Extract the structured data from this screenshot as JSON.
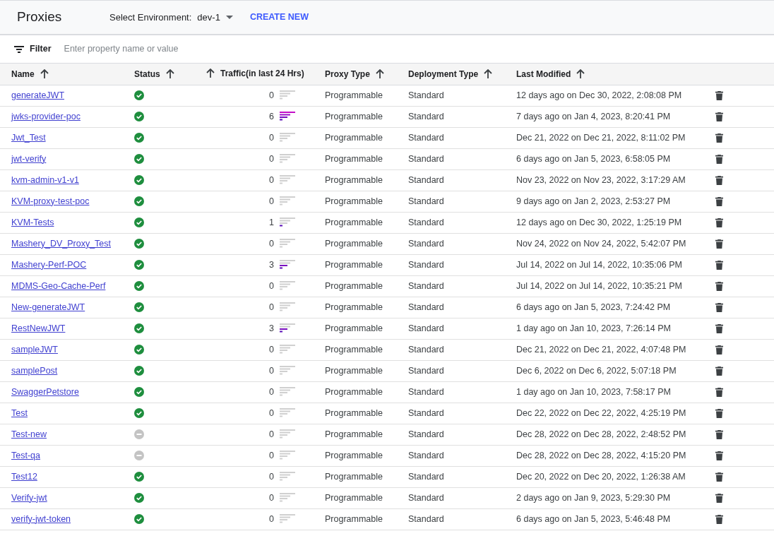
{
  "header": {
    "title": "Proxies",
    "environment_label": "Select Environment:",
    "environment": "dev-1",
    "create_button": "CREATE NEW"
  },
  "filter": {
    "label": "Filter",
    "placeholder": "Enter property name or value"
  },
  "table": {
    "columns": [
      "Name",
      "Status",
      "Traffic(in last 24 Hrs)",
      "Proxy Type",
      "Deployment Type",
      "Last Modified"
    ],
    "rows": [
      {
        "name": "generateJWT",
        "deployed": true,
        "traffic": "0",
        "kind": "idle",
        "proxy_type": "Programmable",
        "deployment_type": "Standard",
        "last_modified": "12 days ago on Dec 30, 2022, 2:08:08 PM"
      },
      {
        "name": "jwks-provider-poc",
        "deployed": true,
        "traffic": "6",
        "kind": "high",
        "proxy_type": "Programmable",
        "deployment_type": "Standard",
        "last_modified": "7 days ago on Jan 4, 2023, 8:20:41 PM"
      },
      {
        "name": "Jwt_Test",
        "deployed": true,
        "traffic": "0",
        "kind": "idle",
        "proxy_type": "Programmable",
        "deployment_type": "Standard",
        "last_modified": "Dec 21, 2022 on Dec 21, 2022, 8:11:02 PM"
      },
      {
        "name": "jwt-verify",
        "deployed": true,
        "traffic": "0",
        "kind": "idle",
        "proxy_type": "Programmable",
        "deployment_type": "Standard",
        "last_modified": "6 days ago on Jan 5, 2023, 6:58:05 PM"
      },
      {
        "name": "kvm-admin-v1-v1",
        "deployed": true,
        "traffic": "0",
        "kind": "idle",
        "proxy_type": "Programmable",
        "deployment_type": "Standard",
        "last_modified": "Nov 23, 2022 on Nov 23, 2022, 3:17:29 AM"
      },
      {
        "name": "KVM-proxy-test-poc",
        "deployed": true,
        "traffic": "0",
        "kind": "idle",
        "proxy_type": "Programmable",
        "deployment_type": "Standard",
        "last_modified": "9 days ago on Jan 2, 2023, 2:53:27 PM"
      },
      {
        "name": "KVM-Tests",
        "deployed": true,
        "traffic": "1",
        "kind": "low",
        "proxy_type": "Programmable",
        "deployment_type": "Standard",
        "last_modified": "12 days ago on Dec 30, 2022, 1:25:19 PM"
      },
      {
        "name": "Mashery_DV_Proxy_Test",
        "deployed": true,
        "traffic": "0",
        "kind": "idle",
        "proxy_type": "Programmable",
        "deployment_type": "Standard",
        "last_modified": "Nov 24, 2022 on Nov 24, 2022, 5:42:07 PM"
      },
      {
        "name": "Mashery-Perf-POC",
        "deployed": true,
        "traffic": "3",
        "kind": "medium",
        "proxy_type": "Programmable",
        "deployment_type": "Standard",
        "last_modified": "Jul 14, 2022 on Jul 14, 2022, 10:35:06 PM"
      },
      {
        "name": "MDMS-Geo-Cache-Perf",
        "deployed": true,
        "traffic": "0",
        "kind": "idle",
        "proxy_type": "Programmable",
        "deployment_type": "Standard",
        "last_modified": "Jul 14, 2022 on Jul 14, 2022, 10:35:21 PM"
      },
      {
        "name": "New-generateJWT",
        "deployed": true,
        "traffic": "0",
        "kind": "idle",
        "proxy_type": "Programmable",
        "deployment_type": "Standard",
        "last_modified": "6 days ago on Jan 5, 2023, 7:24:42 PM"
      },
      {
        "name": "RestNewJWT",
        "deployed": true,
        "traffic": "3",
        "kind": "medium",
        "proxy_type": "Programmable",
        "deployment_type": "Standard",
        "last_modified": "1 day ago on Jan 10, 2023, 7:26:14 PM"
      },
      {
        "name": "sampleJWT",
        "deployed": true,
        "traffic": "0",
        "kind": "idle",
        "proxy_type": "Programmable",
        "deployment_type": "Standard",
        "last_modified": "Dec 21, 2022 on Dec 21, 2022, 4:07:48 PM"
      },
      {
        "name": "samplePost",
        "deployed": true,
        "traffic": "0",
        "kind": "idle",
        "proxy_type": "Programmable",
        "deployment_type": "Standard",
        "last_modified": "Dec 6, 2022 on Dec 6, 2022, 5:07:18 PM"
      },
      {
        "name": "SwaggerPetstore",
        "deployed": true,
        "traffic": "0",
        "kind": "idle",
        "proxy_type": "Programmable",
        "deployment_type": "Standard",
        "last_modified": "1 day ago on Jan 10, 2023, 7:58:17 PM"
      },
      {
        "name": "Test",
        "deployed": true,
        "traffic": "0",
        "kind": "idle",
        "proxy_type": "Programmable",
        "deployment_type": "Standard",
        "last_modified": "Dec 22, 2022 on Dec 22, 2022, 4:25:19 PM"
      },
      {
        "name": "Test-new",
        "deployed": false,
        "traffic": "0",
        "kind": "idle",
        "proxy_type": "Programmable",
        "deployment_type": "Standard",
        "last_modified": "Dec 28, 2022 on Dec 28, 2022, 2:48:52 PM"
      },
      {
        "name": "Test-qa",
        "deployed": false,
        "traffic": "0",
        "kind": "idle",
        "proxy_type": "Programmable",
        "deployment_type": "Standard",
        "last_modified": "Dec 28, 2022 on Dec 28, 2022, 4:15:20 PM"
      },
      {
        "name": "Test12",
        "deployed": true,
        "traffic": "0",
        "kind": "idle",
        "proxy_type": "Programmable",
        "deployment_type": "Standard",
        "last_modified": "Dec 20, 2022 on Dec 20, 2022, 1:26:38 AM"
      },
      {
        "name": "Verify-jwt",
        "deployed": true,
        "traffic": "0",
        "kind": "idle",
        "proxy_type": "Programmable",
        "deployment_type": "Standard",
        "last_modified": "2 days ago on Jan 9, 2023, 5:29:30 PM"
      },
      {
        "name": "verify-jwt-token",
        "deployed": true,
        "traffic": "0",
        "kind": "idle",
        "proxy_type": "Programmable",
        "deployment_type": "Standard",
        "last_modified": "6 days ago on Jan 5, 2023, 5:46:48 PM"
      }
    ]
  }
}
